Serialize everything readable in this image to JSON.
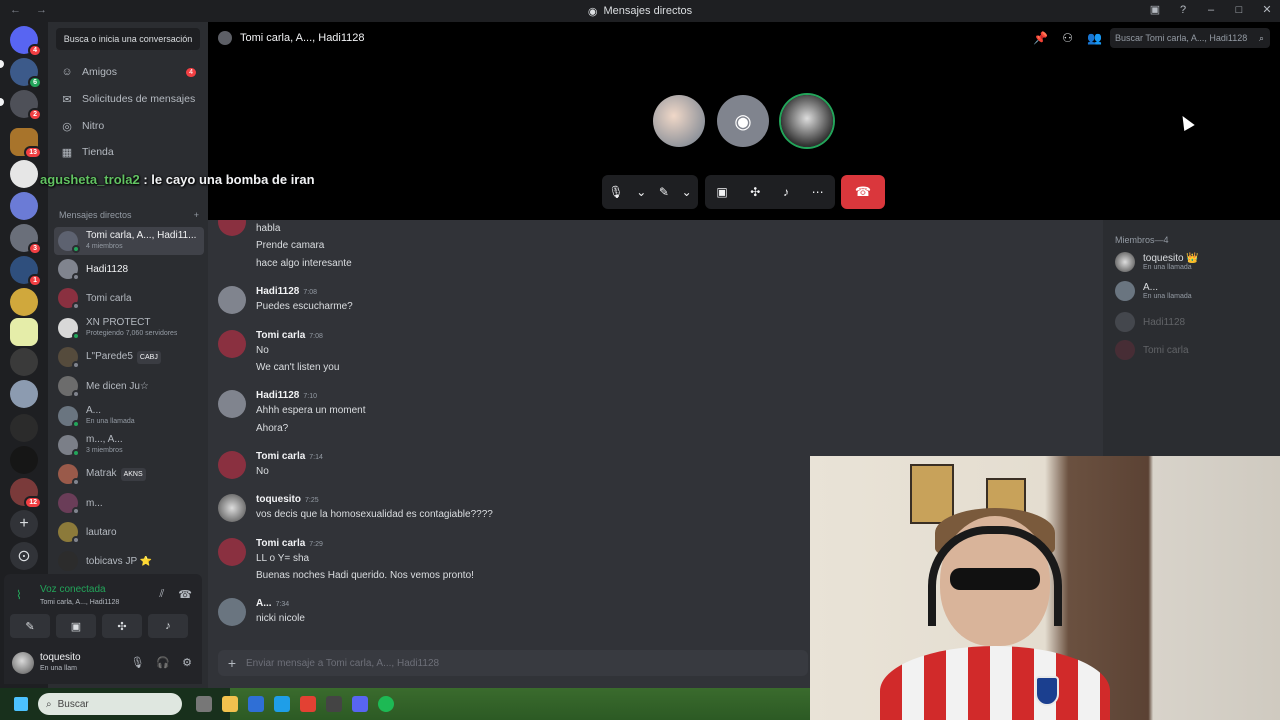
{
  "window": {
    "title": "Mensajes directos"
  },
  "sidebar": {
    "find_placeholder": "Busca o inicia una conversación",
    "nav": [
      {
        "label": "Amigos",
        "icon": "friends-icon",
        "count": "4"
      },
      {
        "label": "Solicitudes de mensajes",
        "icon": "mail-icon"
      },
      {
        "label": "Nitro",
        "icon": "nitro-icon"
      },
      {
        "label": "Tienda",
        "icon": "shop-icon"
      }
    ],
    "dm_header": "Mensajes directos",
    "dms": [
      {
        "name": "Tomi carla, A..., Hadi11...",
        "sub": "4 miembros",
        "active": true
      },
      {
        "name": "Hadi1128",
        "sub": ""
      },
      {
        "name": "Tomi carla",
        "sub": ""
      },
      {
        "name": "XN PROTECT",
        "sub": "Protegiendo 7,060 servidores"
      },
      {
        "name": "L\"Parede5",
        "tag": "CABJ",
        "sub": ""
      },
      {
        "name": "Me dicen Ju☆",
        "sub": ""
      },
      {
        "name": "A...",
        "sub": "En una llamada"
      },
      {
        "name": "m..., A...",
        "sub": "3 miembros"
      },
      {
        "name": "Matrak",
        "tag": "AKNS",
        "sub": ""
      },
      {
        "name": "m...",
        "sub": ""
      },
      {
        "name": "lautaro",
        "sub": ""
      },
      {
        "name": "tobicavs JP ⭐",
        "sub": ""
      }
    ]
  },
  "servers": {
    "badges": [
      "4",
      "6",
      "2",
      "13",
      "3",
      "1",
      "12"
    ]
  },
  "voice": {
    "status": "Voz conectada",
    "channel": "Tomi carla, A..., Hadi1128"
  },
  "user": {
    "name": "toquesito",
    "status": "En una llam"
  },
  "banner": {
    "user": "agusheta_trola2",
    "text": ": le cayo una bomba de iran"
  },
  "call": {
    "channel_title": "Tomi carla, A..., Hadi1128",
    "search_placeholder": "Buscar Tomi carla, A..., Hadi1128"
  },
  "messages": [
    {
      "author": "",
      "time": "",
      "lines": [
        "habla",
        "Prende camara",
        "hace algo interesante"
      ]
    },
    {
      "author": "Hadi1128",
      "time": "7:08",
      "lines": [
        "Puedes escucharme?"
      ]
    },
    {
      "author": "Tomi carla",
      "time": "7:08",
      "lines": [
        "No",
        "We can't listen you"
      ]
    },
    {
      "author": "Hadi1128",
      "time": "7:10",
      "lines": [
        "Ahhh espera un moment",
        "Ahora?"
      ]
    },
    {
      "author": "Tomi carla",
      "time": "7:14",
      "lines": [
        "No"
      ]
    },
    {
      "author": "toquesito",
      "time": "7:25",
      "lines": [
        "vos decis que la homosexualidad es contagiable????"
      ]
    },
    {
      "author": "Tomi carla",
      "time": "7:29",
      "lines": [
        "LL o Y= sha",
        "Buenas noches Hadi querido. Nos vemos pronto!"
      ]
    },
    {
      "author": "A...",
      "time": "7:34",
      "lines": [
        "nicki nicole"
      ]
    }
  ],
  "composer": {
    "placeholder": "Enviar mensaje a Tomi carla, A..., Hadi1128"
  },
  "members": {
    "header": "Miembros—4",
    "list": [
      {
        "name": "toquesito 👑",
        "sub": "En una llamada"
      },
      {
        "name": "A...",
        "sub": "En una llamada"
      },
      {
        "name": "Hadi1128",
        "sub": ""
      },
      {
        "name": "Tomi carla",
        "sub": ""
      }
    ]
  },
  "taskbar": {
    "search_label": "Buscar"
  },
  "colors": {
    "accent": "#5865f2",
    "online": "#23a55a",
    "danger": "#da373c"
  }
}
